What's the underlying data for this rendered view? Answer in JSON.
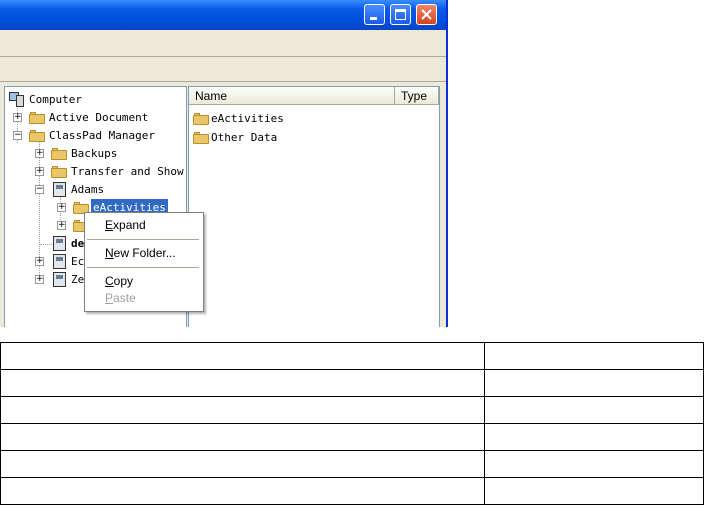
{
  "window": {
    "titlebar": {
      "buttons": [
        "minimize-icon",
        "maximize-icon",
        "close-icon"
      ]
    },
    "colors": {
      "titlebar": "#0a5ae8",
      "selection": "#316ac5",
      "face": "#ece9d8"
    }
  },
  "tree": {
    "items": [
      {
        "label": "Computer",
        "icon": "computer-icon"
      },
      {
        "label": "Active Document",
        "icon": "folder-icon",
        "expander": "+"
      },
      {
        "label": "ClassPad Manager",
        "icon": "folder-icon",
        "expander": "−"
      },
      {
        "label": "Backups",
        "icon": "folder-icon",
        "expander": "+"
      },
      {
        "label": "Transfer and Show",
        "icon": "folder-icon",
        "expander": "+"
      },
      {
        "label": "Adams",
        "icon": "calculator-icon",
        "expander": "−"
      },
      {
        "label": "eActivities",
        "icon": "folder-icon",
        "expander": "+",
        "selected": true
      },
      {
        "label": "",
        "icon": "folder-icon",
        "expander": "+"
      },
      {
        "label": "de",
        "icon": "calculator-icon"
      },
      {
        "label": "Ec",
        "icon": "calculator-icon",
        "expander": "+"
      },
      {
        "label": "Ze",
        "icon": "calculator-icon",
        "expander": "+"
      }
    ]
  },
  "list": {
    "columns": [
      "Name",
      "Type"
    ],
    "rows": [
      {
        "name": "eActivities",
        "icon": "folder-icon"
      },
      {
        "name": "Other Data",
        "icon": "folder-icon"
      }
    ]
  },
  "context_menu": {
    "items": [
      {
        "label": "Expand",
        "mnemonic": "E",
        "enabled": true
      },
      {
        "label": "New Folder...",
        "mnemonic": "N",
        "enabled": true
      },
      {
        "label": "Copy",
        "mnemonic": "C",
        "enabled": true
      },
      {
        "label": "Paste",
        "mnemonic": "P",
        "enabled": false
      }
    ]
  },
  "answer_table": {
    "rows": 6,
    "columns": 2
  }
}
